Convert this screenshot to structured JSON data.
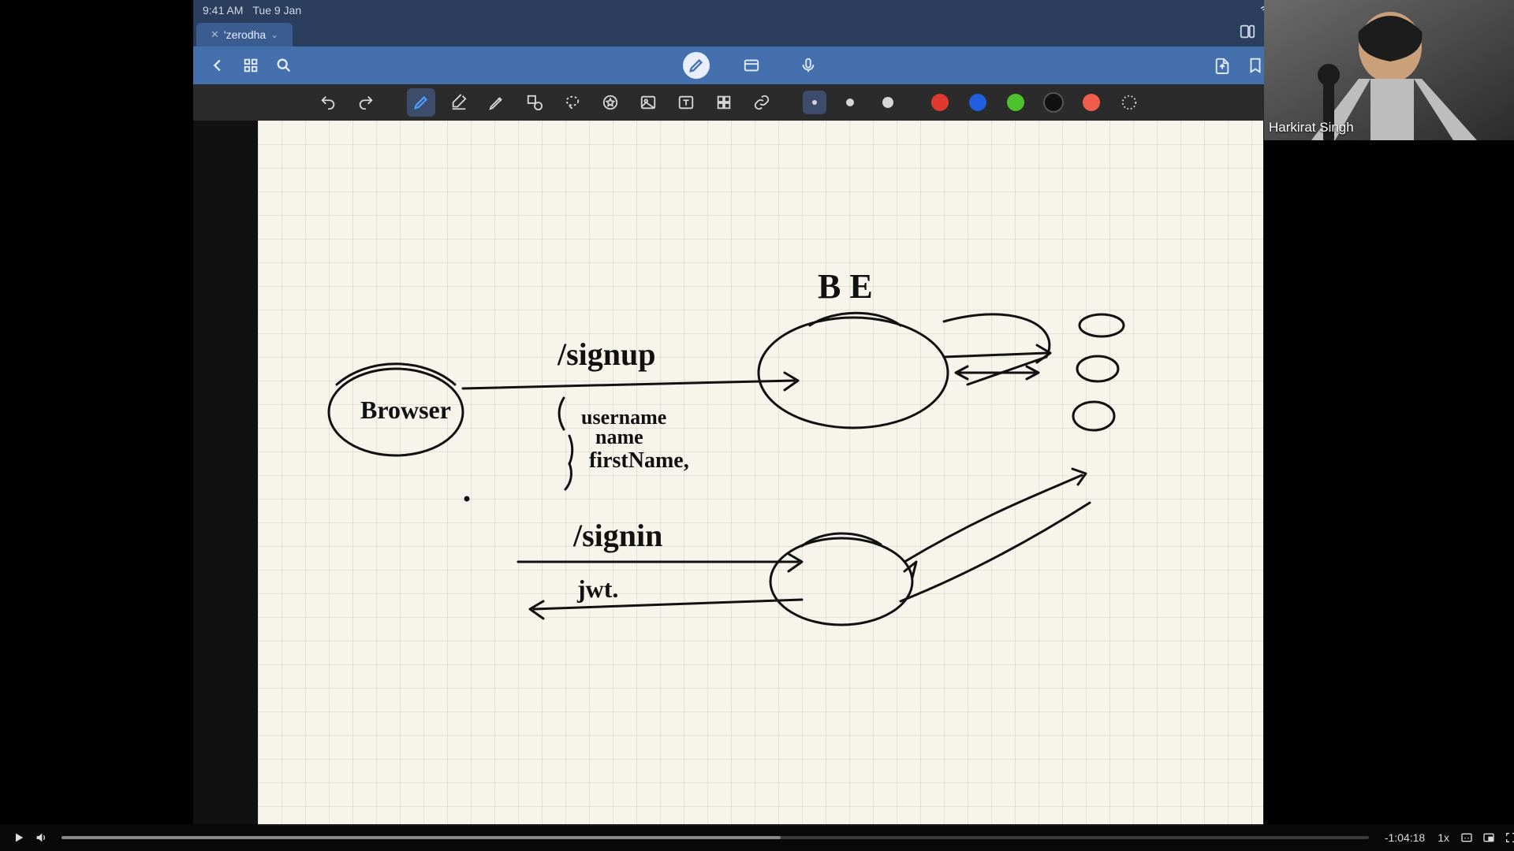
{
  "status": {
    "time": "9:41 AM",
    "date": "Tue 9 Jan"
  },
  "tab": {
    "title": "'zerodha"
  },
  "tools": {
    "undo": "undo",
    "redo": "redo"
  },
  "speaker": {
    "name": "Harkirat Singh"
  },
  "sketch": {
    "browser": "Browser",
    "be": "B E",
    "signup": "/signup",
    "username": "username",
    "name": "name",
    "firstname": "firstName,",
    "signin": "/signin",
    "jwt": "jwt."
  },
  "video": {
    "remaining": "-1:04:18",
    "speed": "1x"
  }
}
